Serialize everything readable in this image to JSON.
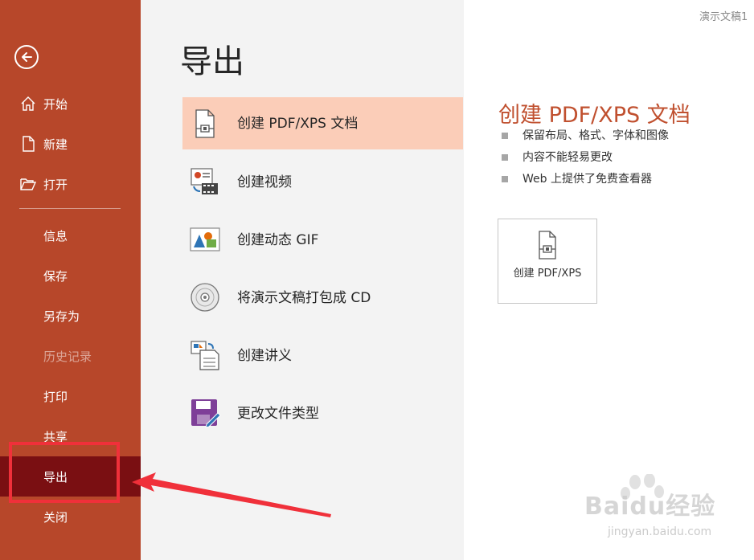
{
  "window": {
    "doc_title": "演示文稿1"
  },
  "sidebar": {
    "top_items": [
      {
        "label": "开始",
        "icon": "home-icon"
      },
      {
        "label": "新建",
        "icon": "new-document-icon"
      },
      {
        "label": "打开",
        "icon": "open-folder-icon"
      }
    ],
    "items": [
      {
        "label": "信息"
      },
      {
        "label": "保存"
      },
      {
        "label": "另存为"
      },
      {
        "label": "历史记录"
      },
      {
        "label": "打印"
      },
      {
        "label": "共享"
      },
      {
        "label": "导出"
      },
      {
        "label": "关闭"
      }
    ],
    "selected": "导出",
    "disabled": "历史记录"
  },
  "main": {
    "title": "导出",
    "options": [
      {
        "label": "创建 PDF/XPS 文档",
        "icon": "pdf-document-icon"
      },
      {
        "label": "创建视频",
        "icon": "video-icon"
      },
      {
        "label": "创建动态 GIF",
        "icon": "gif-image-icon"
      },
      {
        "label": "将演示文稿打包成 CD",
        "icon": "cd-icon"
      },
      {
        "label": "创建讲义",
        "icon": "handout-icon"
      },
      {
        "label": "更改文件类型",
        "icon": "save-file-type-icon"
      }
    ]
  },
  "detail": {
    "title": "创建 PDF/XPS 文档",
    "bullets": [
      "保留布局、格式、字体和图像",
      "内容不能轻易更改",
      "Web 上提供了免费查看器"
    ],
    "button_label": "创建 PDF/XPS"
  },
  "watermark": {
    "text": "Baidu经验",
    "url": "jingyan.baidu.com"
  },
  "colors": {
    "sidebar": "#b7472a",
    "selected_nav": "#7a0f12",
    "selected_option": "#fbcdb8",
    "accent_title": "#c0502f",
    "annotation": "#f0303a"
  }
}
